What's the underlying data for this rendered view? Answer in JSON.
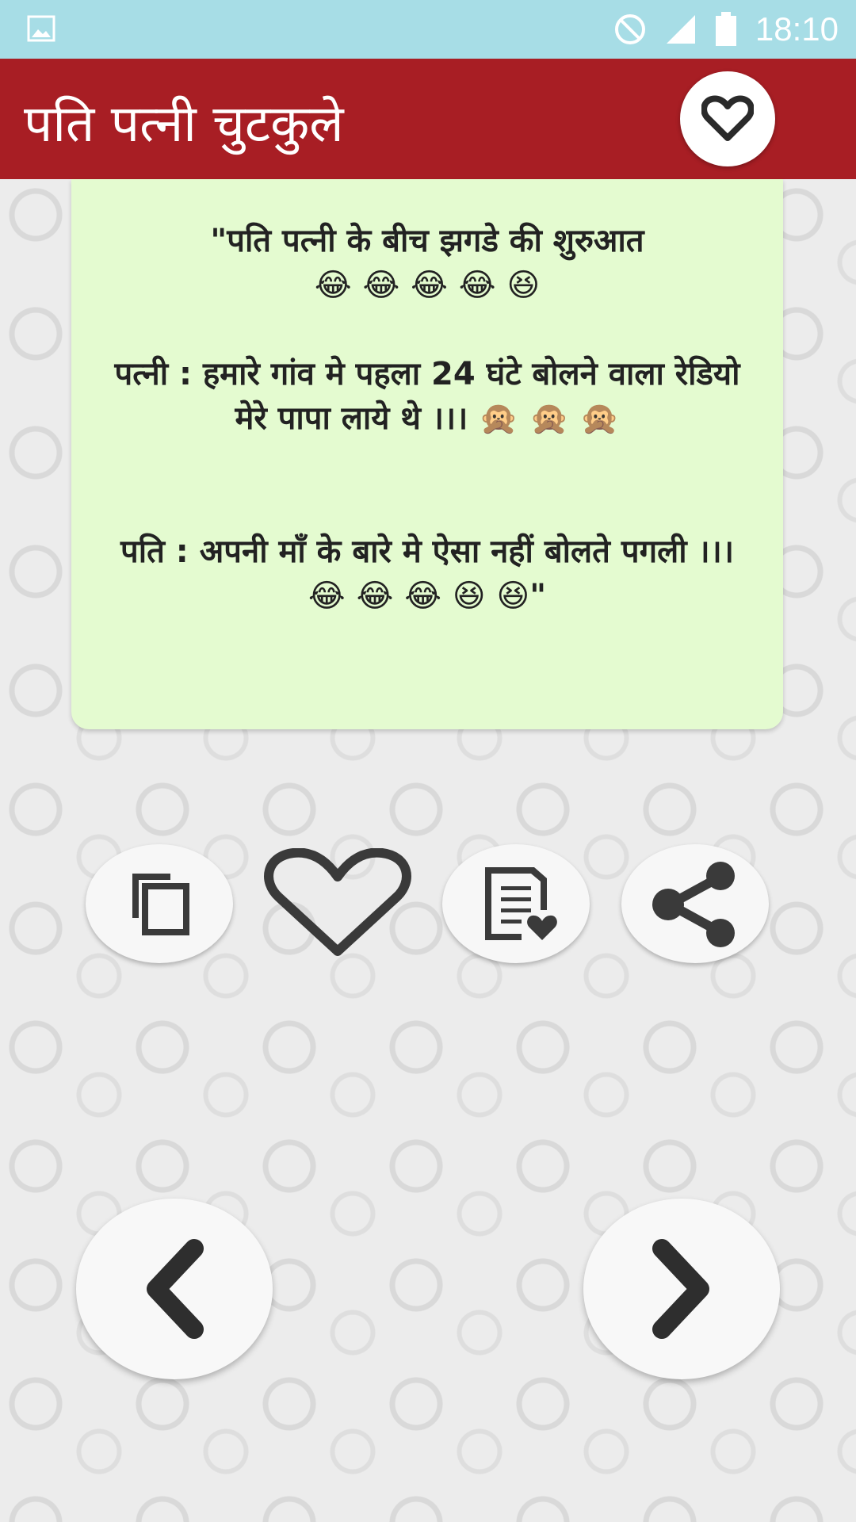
{
  "status_bar": {
    "time": "18:10",
    "icons": [
      "image-icon",
      "do-not-disturb-icon",
      "signal-icon",
      "battery-icon"
    ]
  },
  "app_bar": {
    "title": "पति पत्नी चुटकुले",
    "favorites_icon": "heart-outline-icon"
  },
  "joke": {
    "text": "\"पति पत्नी के बीच झगडे की शुरुआत\n😂 😂 😂 😂 😆\n\nपत्नी : हमारे गांव मे पहला  24  घंटे बोलने वाला रेडियो मेरे पापा लाये थे ।।। 🙊 🙊 🙊\n\n\nपति : अपनी माँ के बारे मे ऐसा नहीं बोलते पगली ।।।\n😂 😂 😂 😆 😆\""
  },
  "actions": {
    "copy_icon": "copy-icon",
    "favorite_icon": "heart-outline-icon",
    "note_icon": "note-heart-icon",
    "share_icon": "share-icon"
  },
  "navigation": {
    "prev_icon": "chevron-left-icon",
    "next_icon": "chevron-right-icon"
  },
  "colors": {
    "status_bar": "#a7dde6",
    "app_bar": "#a81e24",
    "card": "#e4fbd0",
    "background": "#ececec",
    "icon": "#3a3a3a"
  }
}
